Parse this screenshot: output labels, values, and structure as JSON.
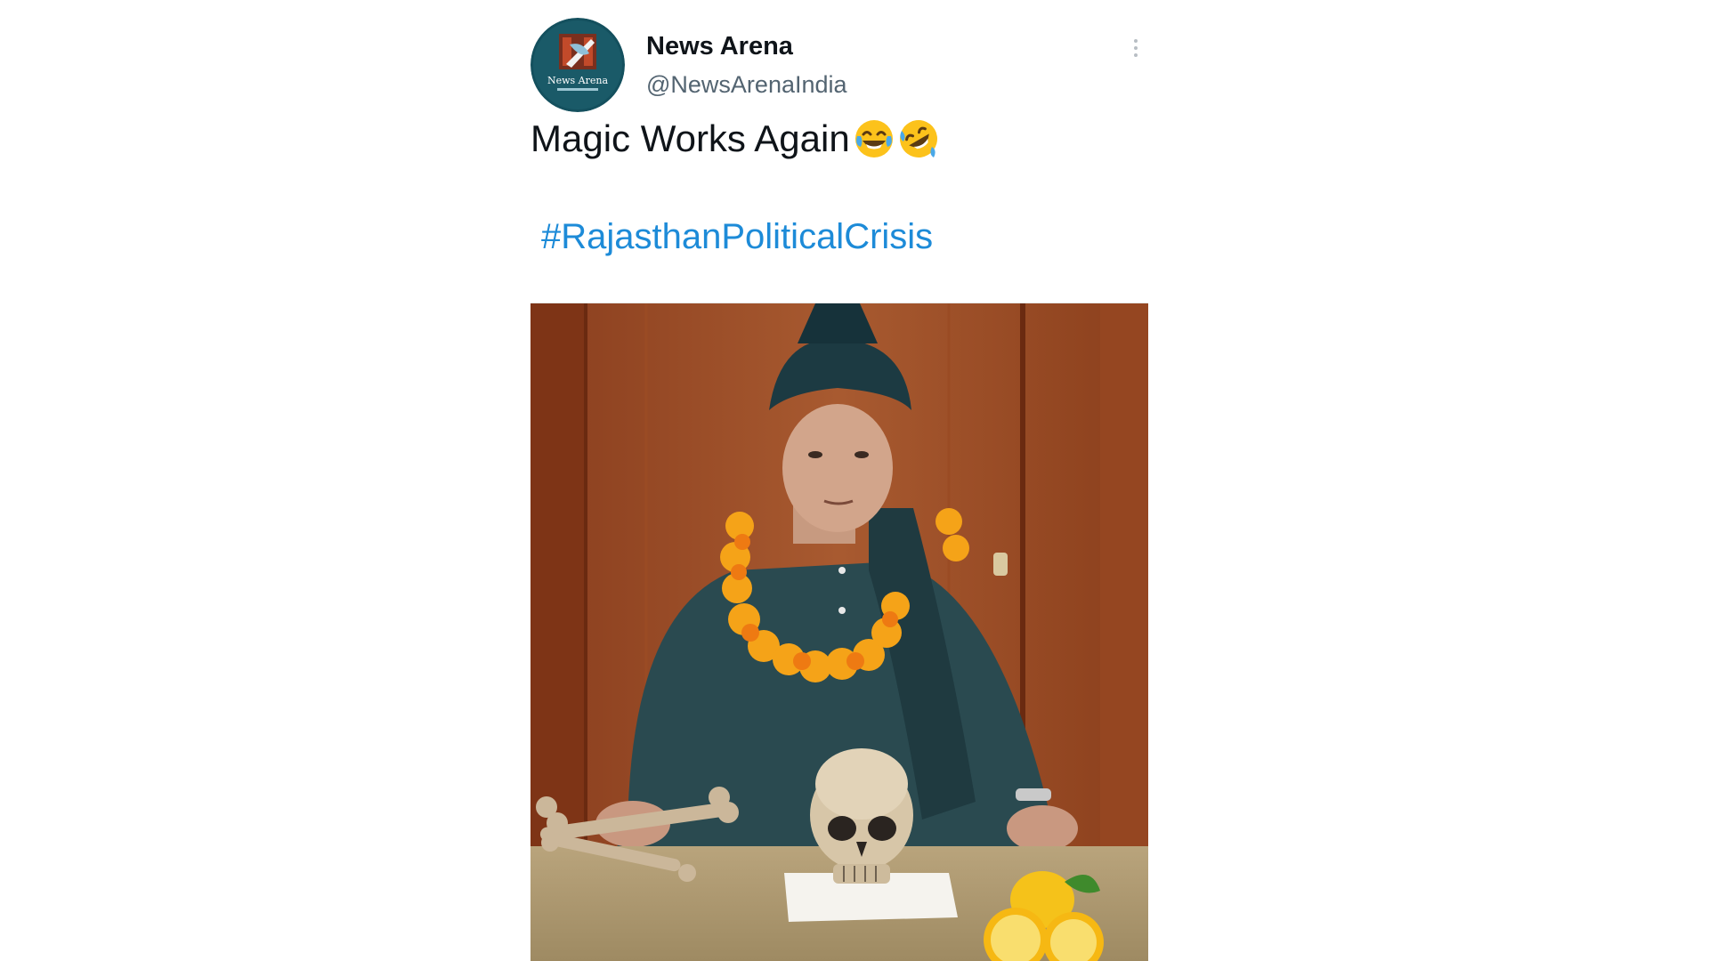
{
  "tweet": {
    "author_name": "News Arena",
    "author_handle": "@NewsArenaIndia",
    "avatar_text": "News Arena",
    "text": "Magic Works Again",
    "emojis": [
      "face-with-tears-of-joy-icon",
      "rolling-on-floor-laughing-icon"
    ],
    "hashtag": "#RajasthanPoliticalCrisis",
    "menu_icon": "more-options-icon"
  },
  "colors": {
    "text_primary": "#0f1419",
    "text_secondary": "#536471",
    "hashtag": "#1d8bd8",
    "avatar_bg": "#14505e"
  }
}
